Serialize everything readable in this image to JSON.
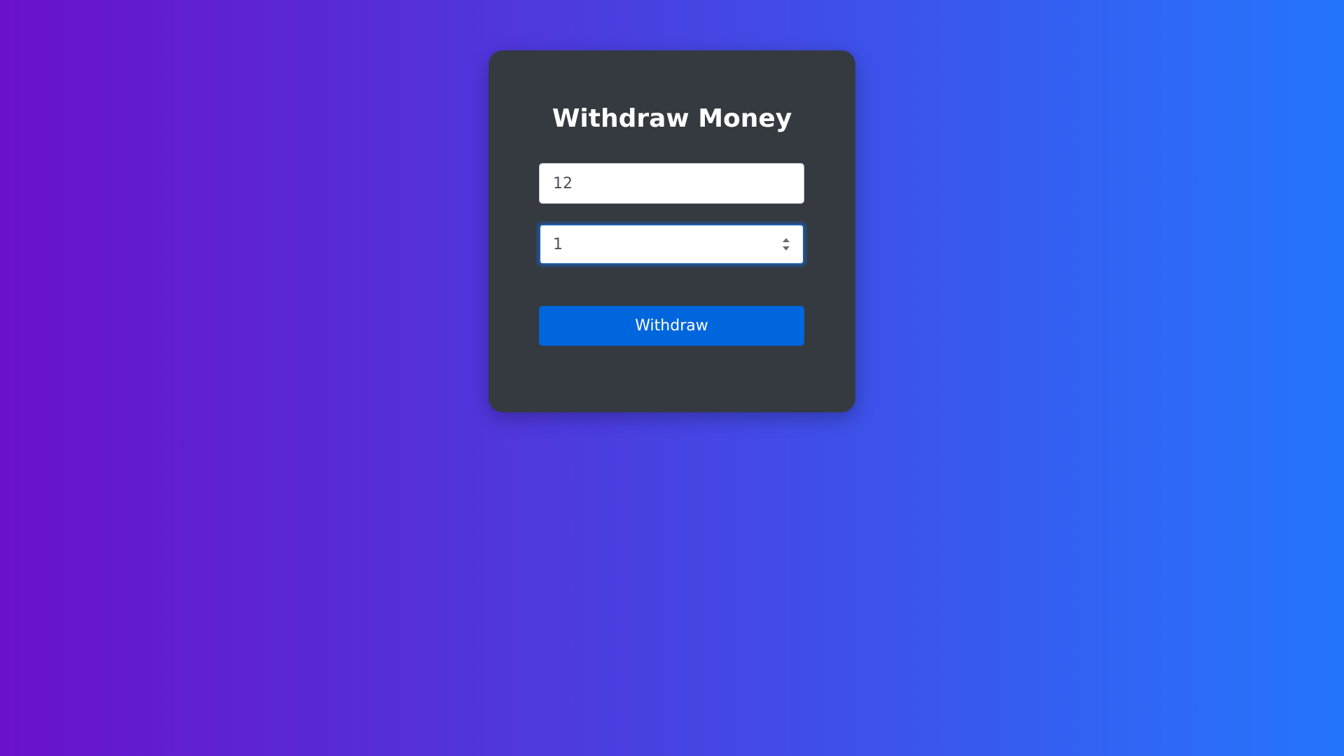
{
  "card": {
    "title": "Withdraw Money"
  },
  "form": {
    "account_value": "12",
    "amount_value": "1",
    "submit_label": "Withdraw"
  },
  "colors": {
    "background_start": "#6a11cb",
    "background_end": "#2575fc",
    "card": "#343a40",
    "button": "#0066dd",
    "focus_border": "#1f5fa8"
  },
  "icons": {
    "stepper": "number-stepper-icon"
  }
}
